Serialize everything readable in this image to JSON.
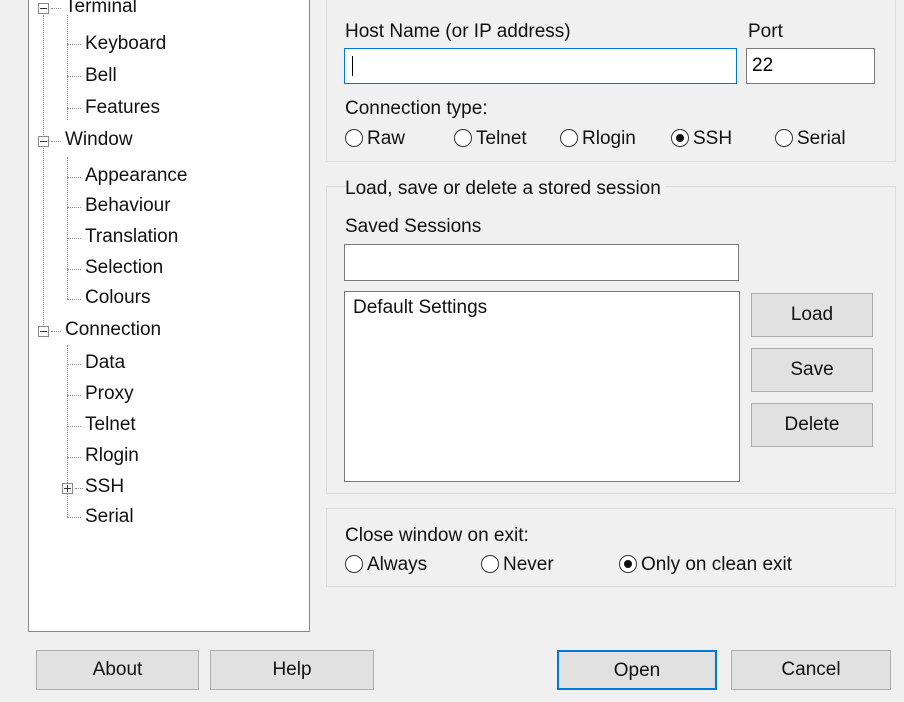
{
  "tree": {
    "items": [
      {
        "label": "Terminal"
      },
      {
        "label": "Keyboard"
      },
      {
        "label": "Bell"
      },
      {
        "label": "Features"
      },
      {
        "label": "Window"
      },
      {
        "label": "Appearance"
      },
      {
        "label": "Behaviour"
      },
      {
        "label": "Translation"
      },
      {
        "label": "Selection"
      },
      {
        "label": "Colours"
      },
      {
        "label": "Connection"
      },
      {
        "label": "Data"
      },
      {
        "label": "Proxy"
      },
      {
        "label": "Telnet"
      },
      {
        "label": "Rlogin"
      },
      {
        "label": "SSH"
      },
      {
        "label": "Serial"
      }
    ]
  },
  "host": {
    "host_label": "Host Name (or IP address)",
    "host_value": "",
    "port_label": "Port",
    "port_value": "22",
    "conn_type_label": "Connection type:",
    "conn_types": [
      {
        "label": "Raw",
        "checked": false
      },
      {
        "label": "Telnet",
        "checked": false
      },
      {
        "label": "Rlogin",
        "checked": false
      },
      {
        "label": "SSH",
        "checked": true
      },
      {
        "label": "Serial",
        "checked": false
      }
    ]
  },
  "sessions": {
    "group_label": "Load, save or delete a stored session",
    "saved_label": "Saved Sessions",
    "saved_value": "",
    "list": [
      "Default Settings"
    ],
    "load_label": "Load",
    "save_label": "Save",
    "delete_label": "Delete"
  },
  "close": {
    "label": "Close window on exit:",
    "options": [
      {
        "label": "Always",
        "checked": false
      },
      {
        "label": "Never",
        "checked": false
      },
      {
        "label": "Only on clean exit",
        "checked": true
      }
    ]
  },
  "footer": {
    "about_label": "About",
    "help_label": "Help",
    "open_label": "Open",
    "cancel_label": "Cancel"
  },
  "colors": {
    "focus_blue": "#0078d7",
    "button_face": "#e1e1e1",
    "dialog_bg": "#f0f0f0"
  }
}
